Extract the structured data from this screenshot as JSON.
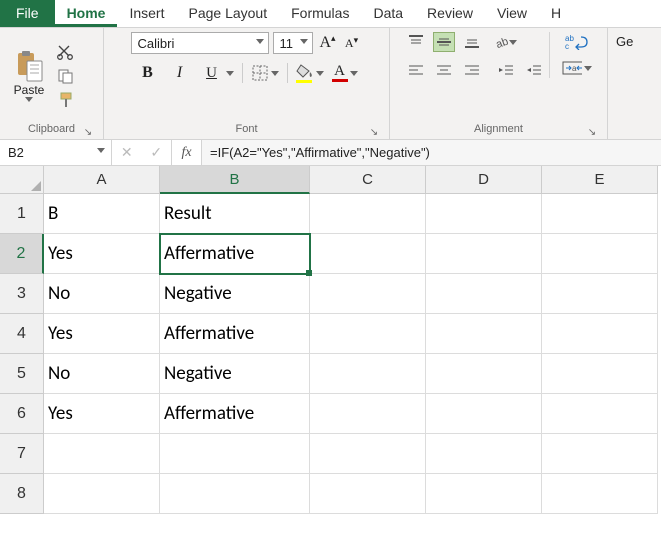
{
  "menu": {
    "file": "File",
    "tabs": [
      "Home",
      "Insert",
      "Page Layout",
      "Formulas",
      "Data",
      "Review",
      "View",
      "H"
    ],
    "active_index": 0
  },
  "ribbon": {
    "clipboard": {
      "label": "Clipboard",
      "paste": "Paste"
    },
    "font": {
      "label": "Font",
      "name": "Calibri",
      "size": "11",
      "increase": "A",
      "decrease": "A",
      "bold": "B",
      "italic": "I",
      "underline": "U",
      "fill_color": "#ffff00",
      "font_color": "#d20000",
      "char_A": "A"
    },
    "alignment": {
      "label": "Alignment"
    },
    "general": {
      "text": "Ge"
    }
  },
  "formula_bar": {
    "namebox": "B2",
    "fx": "fx",
    "cancel": "✕",
    "enter": "✓",
    "formula": "=IF(A2=\"Yes\",\"Affirmative\",\"Negative\")"
  },
  "grid": {
    "columns": [
      "A",
      "B",
      "C",
      "D",
      "E"
    ],
    "selected_col": 1,
    "selected_row": 1,
    "rows": [
      {
        "n": "1",
        "cells": [
          "B",
          "Result",
          "",
          "",
          ""
        ]
      },
      {
        "n": "2",
        "cells": [
          "Yes",
          "Affermative",
          "",
          "",
          ""
        ]
      },
      {
        "n": "3",
        "cells": [
          "No",
          "Negative",
          "",
          "",
          ""
        ]
      },
      {
        "n": "4",
        "cells": [
          "Yes",
          "Affermative",
          "",
          "",
          ""
        ]
      },
      {
        "n": "5",
        "cells": [
          "No",
          "Negative",
          "",
          "",
          ""
        ]
      },
      {
        "n": "6",
        "cells": [
          "Yes",
          "Affermative",
          "",
          "",
          ""
        ]
      },
      {
        "n": "7",
        "cells": [
          "",
          "",
          "",
          "",
          ""
        ]
      },
      {
        "n": "8",
        "cells": [
          "",
          "",
          "",
          "",
          ""
        ]
      }
    ]
  }
}
